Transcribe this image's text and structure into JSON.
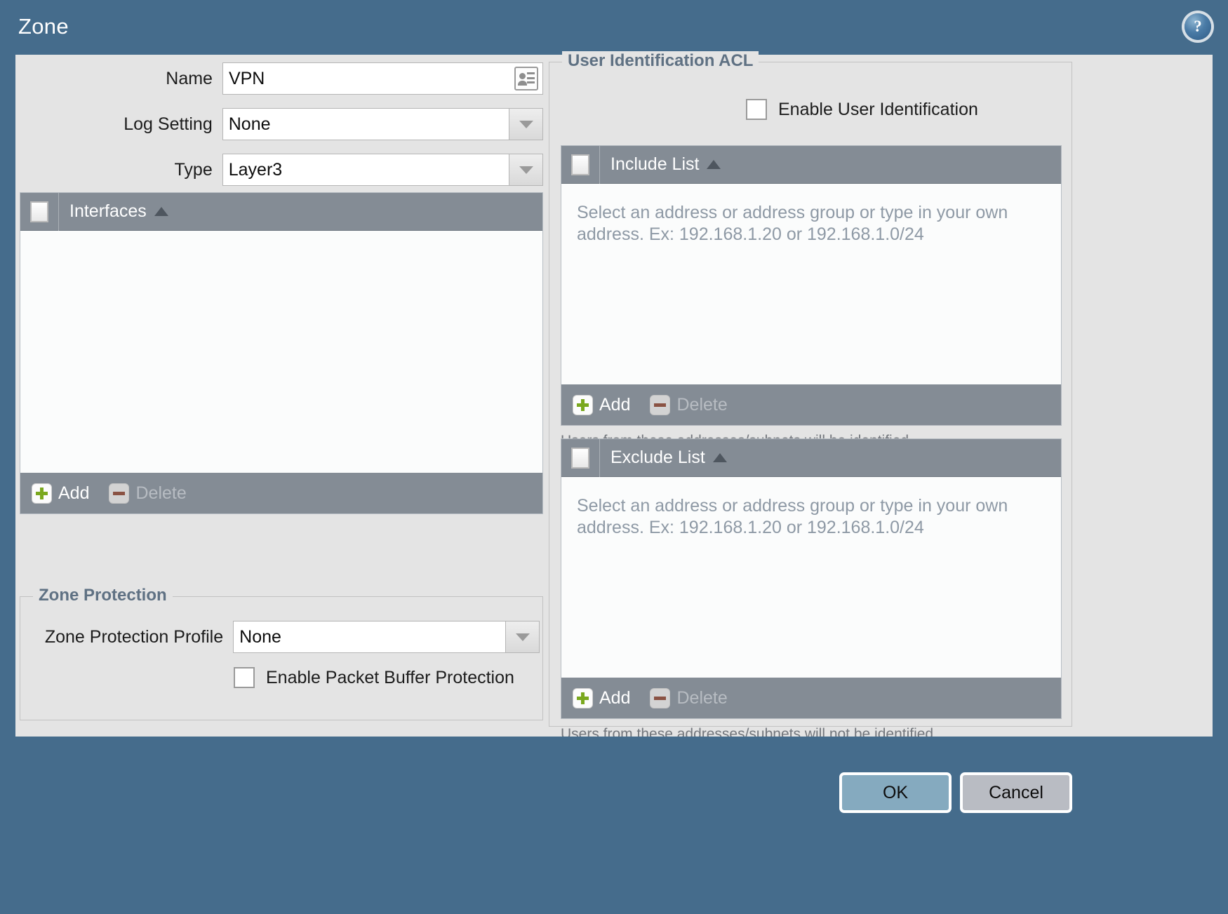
{
  "window": {
    "title": "Zone",
    "help_icon": "help-circle-icon",
    "help_glyph": "?"
  },
  "form": {
    "name": {
      "label": "Name",
      "value": "VPN",
      "icon": "address-book-icon"
    },
    "log_setting": {
      "label": "Log Setting",
      "value": "None",
      "icon": "chevron-down-icon"
    },
    "type": {
      "label": "Type",
      "value": "Layer3",
      "icon": "chevron-down-icon"
    }
  },
  "interfaces": {
    "header_title": "Interfaces",
    "sort_icon": "sort-ascending-icon",
    "rows": [],
    "toolbar": {
      "add_label": "Add",
      "add_icon": "plus-icon",
      "delete_label": "Delete",
      "delete_icon": "minus-icon"
    }
  },
  "zone_protection": {
    "legend": "Zone Protection",
    "profile": {
      "label": "Zone Protection Profile",
      "value": "None",
      "icon": "chevron-down-icon"
    },
    "packet_buffer": {
      "label": "Enable Packet Buffer Protection",
      "checked": false
    }
  },
  "user_id_acl": {
    "legend": "User Identification ACL",
    "enable": {
      "label": "Enable User Identification",
      "checked": false
    },
    "include_list": {
      "header_title": "Include List",
      "sort_icon": "sort-ascending-icon",
      "placeholder": "Select an address or address group or type in your own address. Ex: 192.168.1.20 or 192.168.1.0/24",
      "toolbar": {
        "add_label": "Add",
        "add_icon": "plus-icon",
        "delete_label": "Delete",
        "delete_icon": "minus-icon"
      },
      "hint": "Users from these addresses/subnets will be identified."
    },
    "exclude_list": {
      "header_title": "Exclude List",
      "sort_icon": "sort-ascending-icon",
      "placeholder": "Select an address or address group or type in your own address. Ex: 192.168.1.20 or 192.168.1.0/24",
      "toolbar": {
        "add_label": "Add",
        "add_icon": "plus-icon",
        "delete_label": "Delete",
        "delete_icon": "minus-icon"
      },
      "hint": "Users from these addresses/subnets will not be identified."
    }
  },
  "footer": {
    "ok_label": "OK",
    "cancel_label": "Cancel"
  },
  "colors": {
    "header_blue": "#456c8c",
    "body_grey": "#e4e4e4",
    "grid_header_grey": "#848c95",
    "legend_blue": "#5f7183",
    "ok_button": "#85aabf",
    "cancel_button": "#b9bcc3",
    "plus_green": "#7aa81f",
    "minus_brown": "#8a5243"
  }
}
